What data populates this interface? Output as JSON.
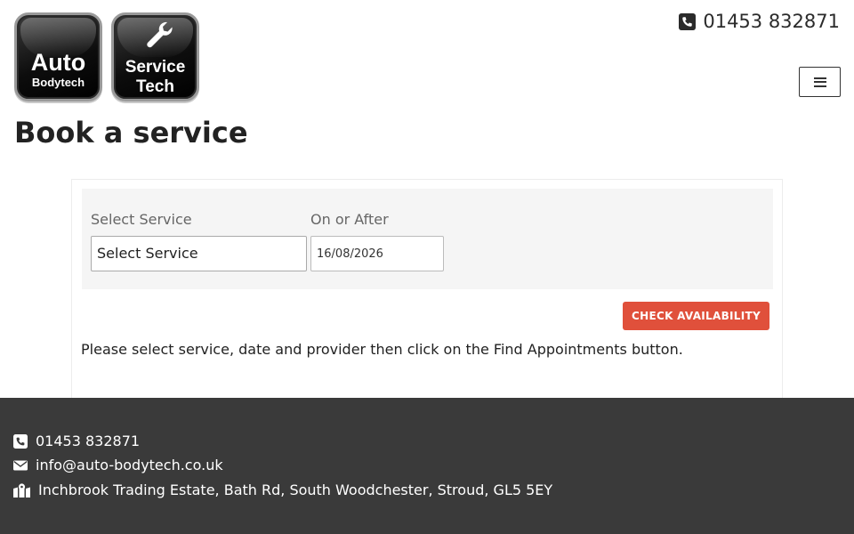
{
  "header": {
    "logo_auto": {
      "line1": "Auto",
      "line2": "Bodytech"
    },
    "logo_service": {
      "line1": "Service",
      "line2": "Tech"
    },
    "phone": "01453 832871"
  },
  "page": {
    "title": "Book a service"
  },
  "booking": {
    "service_label": "Select Service",
    "service_value": "Select Service",
    "date_label": "On or After",
    "date_value": "16/08/2026",
    "check_button": "CHECK AVAILABILITY",
    "instructions": "Please select service, date and provider then click on the Find Appointments button."
  },
  "footer": {
    "phone": "01453 832871",
    "email": "info@auto-bodytech.co.uk",
    "address": "Inchbrook Trading Estate, Bath Rd, South Woodchester, Stroud, GL5 5EY"
  },
  "icons": {
    "phone": "phone-square-icon",
    "email": "envelope-icon",
    "address": "map-marked-icon",
    "menu": "hamburger-menu-icon"
  },
  "colors": {
    "accent_button": "#e0503b",
    "footer_bg": "#3a3a3a",
    "filter_bg": "#f5f5f5"
  }
}
